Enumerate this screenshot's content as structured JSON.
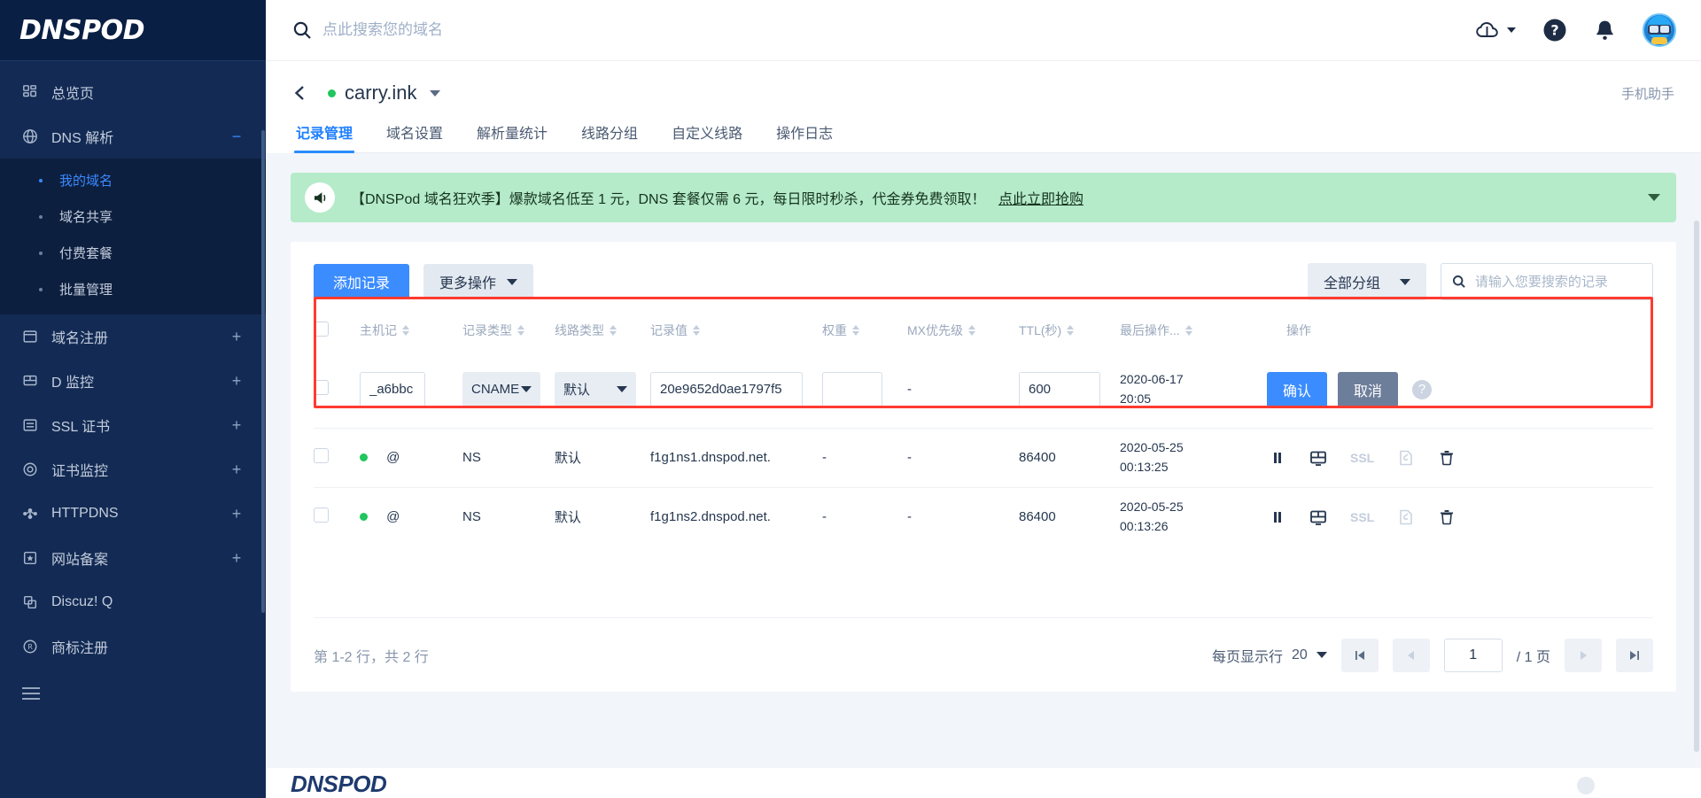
{
  "brand": {
    "logo": "DNSPOD",
    "footer_logo": "DNSPOD"
  },
  "topbar": {
    "search_placeholder": "点此搜索您的域名",
    "search_value": "",
    "icons": {
      "cloud": "cloud-icon",
      "help": "help-circle-icon",
      "bell": "bell-icon",
      "avatar": "user-avatar"
    }
  },
  "sidebar": {
    "items": [
      {
        "label": "总览页",
        "icon": "dashboard-icon",
        "expand": "",
        "active": false
      },
      {
        "label": "DNS 解析",
        "icon": "globe-icon",
        "expand": "−",
        "active": true
      },
      {
        "label": "域名注册",
        "icon": "window-icon",
        "expand": "+",
        "active": false
      },
      {
        "label": "D 监控",
        "icon": "monitor-icon",
        "expand": "+",
        "active": false
      },
      {
        "label": "SSL 证书",
        "icon": "certificate-icon",
        "expand": "+",
        "active": false
      },
      {
        "label": "证书监控",
        "icon": "target-icon",
        "expand": "+",
        "active": false
      },
      {
        "label": "HTTPDNS",
        "icon": "nodes-icon",
        "expand": "+",
        "active": false
      },
      {
        "label": "网站备案",
        "icon": "star-box-icon",
        "expand": "+",
        "active": false
      },
      {
        "label": "Discuz! Q",
        "icon": "layers-icon",
        "expand": "",
        "active": false
      },
      {
        "label": "商标注册",
        "icon": "registered-icon",
        "expand": "",
        "active": false
      }
    ],
    "subitems": [
      {
        "label": "我的域名",
        "active": true
      },
      {
        "label": "域名共享",
        "active": false
      },
      {
        "label": "付费套餐",
        "active": false
      },
      {
        "label": "批量管理",
        "active": false
      }
    ],
    "collapse": "menu-collapse-icon"
  },
  "domain_header": {
    "back": "back-arrow",
    "name": "carry.ink",
    "status": "active",
    "mobile_helper": "手机助手"
  },
  "tabs": [
    {
      "label": "记录管理",
      "active": true
    },
    {
      "label": "域名设置",
      "active": false
    },
    {
      "label": "解析量统计",
      "active": false
    },
    {
      "label": "线路分组",
      "active": false
    },
    {
      "label": "自定义线路",
      "active": false
    },
    {
      "label": "操作日志",
      "active": false
    }
  ],
  "banner": {
    "text": "【DNSPod 域名狂欢季】爆款域名低至 1 元，DNS 套餐仅需 6 元，每日限时秒杀，代金券免费领取！",
    "link": "点此立即抢购",
    "icon": "megaphone-icon"
  },
  "toolbar": {
    "add_record": "添加记录",
    "more_ops": "更多操作",
    "group_filter": "全部分组",
    "record_search_placeholder": "请输入您要搜索的记录",
    "record_search_value": ""
  },
  "table": {
    "headers": [
      {
        "label": "主机记",
        "sortable": true
      },
      {
        "label": "记录类型",
        "sortable": true
      },
      {
        "label": "线路类型",
        "sortable": true
      },
      {
        "label": "记录值",
        "sortable": true
      },
      {
        "label": "权重",
        "sortable": true
      },
      {
        "label": "MX优先级",
        "sortable": true
      },
      {
        "label": "TTL(秒)",
        "sortable": true
      },
      {
        "label": "最后操作...",
        "sortable": true
      },
      {
        "label": "操作",
        "sortable": false
      }
    ],
    "edit_row": {
      "host": "_a6bbc",
      "type": "CNAME",
      "line": "默认",
      "value": "20e9652d0ae1797f5",
      "weight": "",
      "mx": "-",
      "ttl": "600",
      "last_op_date": "2020-06-17",
      "last_op_time": "20:05",
      "confirm": "确认",
      "cancel": "取消",
      "help": "help-icon"
    },
    "rows": [
      {
        "host": "@",
        "type": "NS",
        "line": "默认",
        "value": "f1g1ns1.dnspod.net.",
        "weight": "-",
        "mx": "-",
        "ttl": "86400",
        "last_op_date": "2020-05-25",
        "last_op_time": "00:13:25",
        "status": "active",
        "ops": [
          "pause-icon",
          "monitor-icon",
          "SSL",
          "edit-icon",
          "delete-icon"
        ]
      },
      {
        "host": "@",
        "type": "NS",
        "line": "默认",
        "value": "f1g1ns2.dnspod.net.",
        "weight": "-",
        "mx": "-",
        "ttl": "86400",
        "last_op_date": "2020-05-25",
        "last_op_time": "00:13:26",
        "status": "active",
        "ops": [
          "pause-icon",
          "monitor-icon",
          "SSL",
          "edit-icon",
          "delete-icon"
        ]
      }
    ]
  },
  "pager": {
    "summary": "第 1-2 行，共 2 行",
    "per_page_label": "每页显示行",
    "per_page_value": "20",
    "current_page": "1",
    "total_pages": "/ 1 页"
  },
  "colors": {
    "brand_dark": "#0A1F44",
    "sidebar": "#132B54",
    "accent": "#3B8CFF",
    "highlight": "#FF3B30",
    "banner": "#B5EBC9",
    "status_green": "#22C55E"
  }
}
